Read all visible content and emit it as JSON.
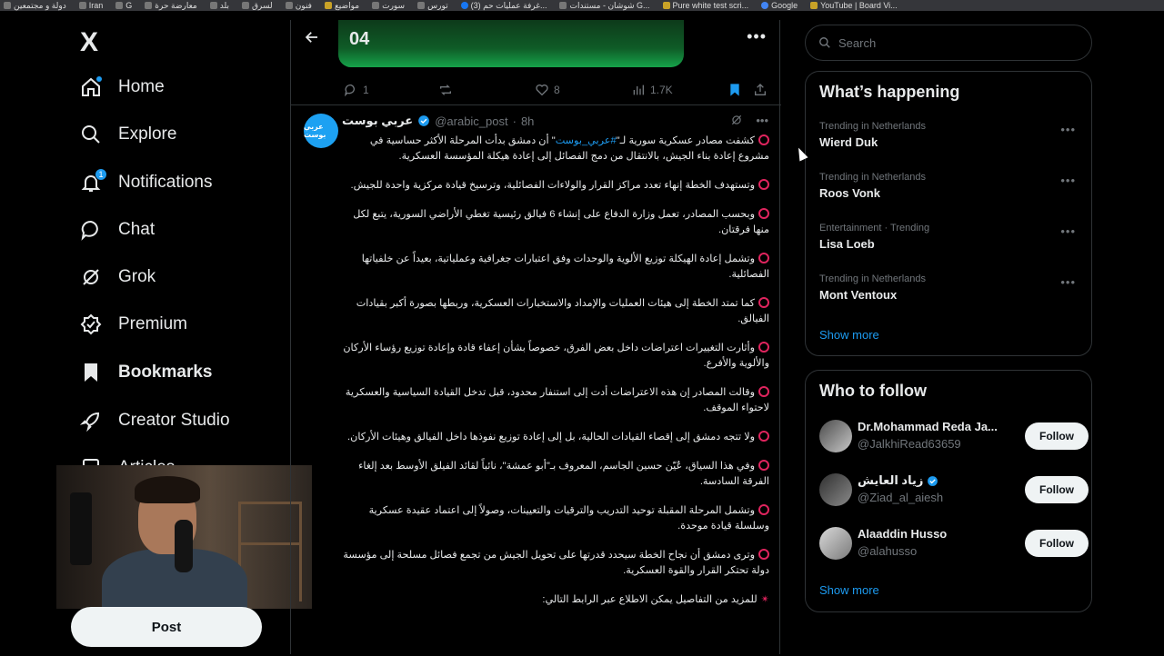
{
  "bookmarks_bar": {
    "items": [
      {
        "label": "دولة و مجتمعين",
        "style": "plain"
      },
      {
        "label": "Iran",
        "style": "plain"
      },
      {
        "label": "G",
        "style": "plain"
      },
      {
        "label": "معارضة حرة",
        "style": "plain"
      },
      {
        "label": "بلد",
        "style": "plain"
      },
      {
        "label": "لسرق",
        "style": "plain"
      },
      {
        "label": "فنون",
        "style": "plain"
      },
      {
        "label": "مواضيع",
        "style": "alt"
      },
      {
        "label": "سورت",
        "style": "plain"
      },
      {
        "label": "تورس",
        "style": "plain"
      },
      {
        "label": "(3) غرفة عمليات حم...",
        "style": "fb"
      },
      {
        "label": "شوشان - مستندات G...",
        "style": "plain"
      },
      {
        "label": "Pure white test scri...",
        "style": "alt"
      },
      {
        "label": "Google",
        "style": "g"
      },
      {
        "label": "YouTube | Board Vi...",
        "style": "alt"
      }
    ]
  },
  "nav": {
    "logo": "X",
    "items": [
      {
        "label": "Home",
        "icon": "home-icon",
        "name": "nav-item-home"
      },
      {
        "label": "Explore",
        "icon": "search-icon",
        "name": "nav-item-explore"
      },
      {
        "label": "Notifications",
        "icon": "bell-icon",
        "name": "nav-item-notifications",
        "badge": "1"
      },
      {
        "label": "Chat",
        "icon": "chat-icon",
        "name": "nav-item-chat"
      },
      {
        "label": "Grok",
        "icon": "grok-icon",
        "name": "nav-item-grok"
      },
      {
        "label": "Premium",
        "icon": "premium-icon",
        "name": "nav-item-premium"
      },
      {
        "label": "Bookmarks",
        "icon": "bookmark-icon",
        "name": "nav-item-bookmarks",
        "active": true
      },
      {
        "label": "Creator Studio",
        "icon": "rocket-icon",
        "name": "nav-item-creator-studio"
      },
      {
        "label": "Articles",
        "icon": "article-icon",
        "name": "nav-item-articles"
      }
    ],
    "post_button": "Post"
  },
  "top_post": {
    "media_title": "04",
    "replies": "1",
    "likes": "8",
    "views": "1.7K"
  },
  "tweet": {
    "author_name": "عربي بوست",
    "author_handle": "@arabic_post",
    "time": "8h",
    "avatar_text": "عربي بوست",
    "paragraphs": [
      {
        "pre": "كشفت مصادر عسكرية سورية لـ\"",
        "tag": "#عربي_بوست",
        "post": "\" أن دمشق بدأت المرحلة الأكثر حساسية في مشروع إعادة بناء الجيش، بالانتقال من دمج الفصائل إلى إعادة هيكلة المؤسسة العسكرية."
      },
      {
        "pre": "وتستهدف الخطة إنهاء تعدد مراكز القرار والولاءات الفصائلية، وترسيخ قيادة مركزية واحدة للجيش."
      },
      {
        "pre": "وبحسب المصادر، تعمل وزارة الدفاع على إنشاء 6 فيالق رئيسية تغطي الأراضي السورية، يتبع لكل منها فرقتان."
      },
      {
        "pre": "وتشمل إعادة الهيكلة توزيع الألوية والوحدات وفق اعتبارات جغرافية وعملياتية، بعيداً عن خلفياتها الفصائلية."
      },
      {
        "pre": "كما تمتد الخطة إلى هيئات العمليات والإمداد والاستخبارات العسكرية، وربطها بصورة أكبر بقيادات الفيالق."
      },
      {
        "pre": "وأثارت التغييرات اعتراضات داخل بعض الفرق، خصوصاً بشأن إعفاء قادة وإعادة توزيع رؤساء الأركان والألوية والأفرع."
      },
      {
        "pre": "وقالت المصادر إن هذه الاعتراضات أدت إلى استنفار محدود، قبل تدخل القيادة السياسية والعسكرية لاحتواء الموقف."
      },
      {
        "pre": "ولا تتجه دمشق إلى إقصاء القيادات الحالية، بل إلى إعادة توزيع نفوذها داخل الفيالق وهيئات الأركان."
      },
      {
        "pre": "وفي هذا السياق، عُيّن حسين الجاسم، المعروف بـ\"أبو عمشة\"، نائباً لقائد الفيلق الأوسط بعد إلغاء الفرقة السادسة."
      },
      {
        "pre": "وتشمل المرحلة المقبلة توحيد التدريب والترقيات والتعيينات، وصولاً إلى اعتماد عقيدة عسكرية وسلسلة قيادة موحدة."
      },
      {
        "pre": "وترى دمشق أن نجاح الخطة سيحدد قدرتها على تحويل الجيش من تجمع فصائل مسلحة إلى مؤسسة دولة تحتكر القرار والقوة العسكرية."
      }
    ],
    "footer": "للمزيد من التفاصيل يمكن الاطلاع عبر الرابط التالي:"
  },
  "search": {
    "placeholder": "Search"
  },
  "trending": {
    "title": "What’s happening",
    "items": [
      {
        "context": "Trending in Netherlands",
        "topic": "Wierd Duk"
      },
      {
        "context": "Trending in Netherlands",
        "topic": "Roos Vonk"
      },
      {
        "context": "Entertainment · Trending",
        "topic": "Lisa Loeb"
      },
      {
        "context": "Trending in Netherlands",
        "topic": "Mont Ventoux"
      }
    ],
    "show_more": "Show more"
  },
  "who_to_follow": {
    "title": "Who to follow",
    "items": [
      {
        "name": "Dr.Mohammad Reda Ja...",
        "handle": "@JalkhiRead63659",
        "verified": false,
        "button": "Follow"
      },
      {
        "name": "زياد العايش",
        "handle": "@Ziad_al_aiesh",
        "verified": true,
        "button": "Follow"
      },
      {
        "name": "Alaaddin Husso",
        "handle": "@alahusso",
        "verified": false,
        "button": "Follow"
      }
    ],
    "show_more": "Show more"
  },
  "colors": {
    "accent": "#1d9bf0",
    "background": "#000000",
    "border": "#2f3336",
    "muted": "#71767b",
    "red_circle": "#e0245e"
  }
}
